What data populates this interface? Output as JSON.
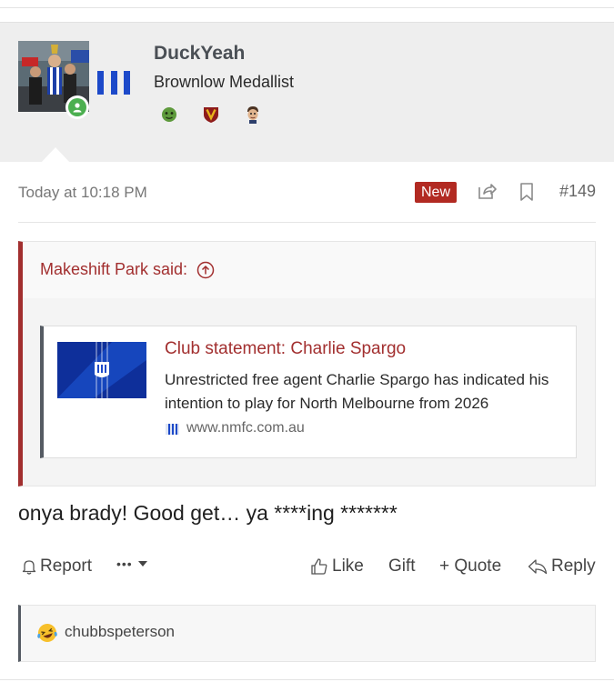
{
  "post": {
    "user": {
      "name": "DuckYeah",
      "title": "Brownlow Medallist",
      "avatar_icon": "player-photo-avatar",
      "online": true,
      "team_color": "#1c49c9",
      "badges": [
        "green-face-badge-icon",
        "v-shield-badge-icon",
        "caricature-face-badge-icon"
      ]
    },
    "timestamp": "Today at 10:18 PM",
    "new_label": "New",
    "post_number": "#149",
    "quote": {
      "attribution": "Makeshift Park said:",
      "unfurl": {
        "title": "Club statement: Charlie Spargo",
        "description": "Unrestricted free agent Charlie Spargo has indicated his intention to play for North Melbourne from 2026",
        "domain": "www.nmfc.com.au"
      }
    },
    "body": "onya brady! Good get… ya ****ing *******",
    "actions": {
      "report": "Report",
      "more": "•••",
      "like": "Like",
      "gift": "Gift",
      "quote": "+ Quote",
      "reply": "Reply"
    },
    "reactions": {
      "emoji": "laughing-crying-face-icon",
      "users": "chubbspeterson"
    }
  },
  "colors": {
    "accent": "#a22f2f",
    "new_badge": "#b22a22",
    "online": "#4caf50"
  }
}
